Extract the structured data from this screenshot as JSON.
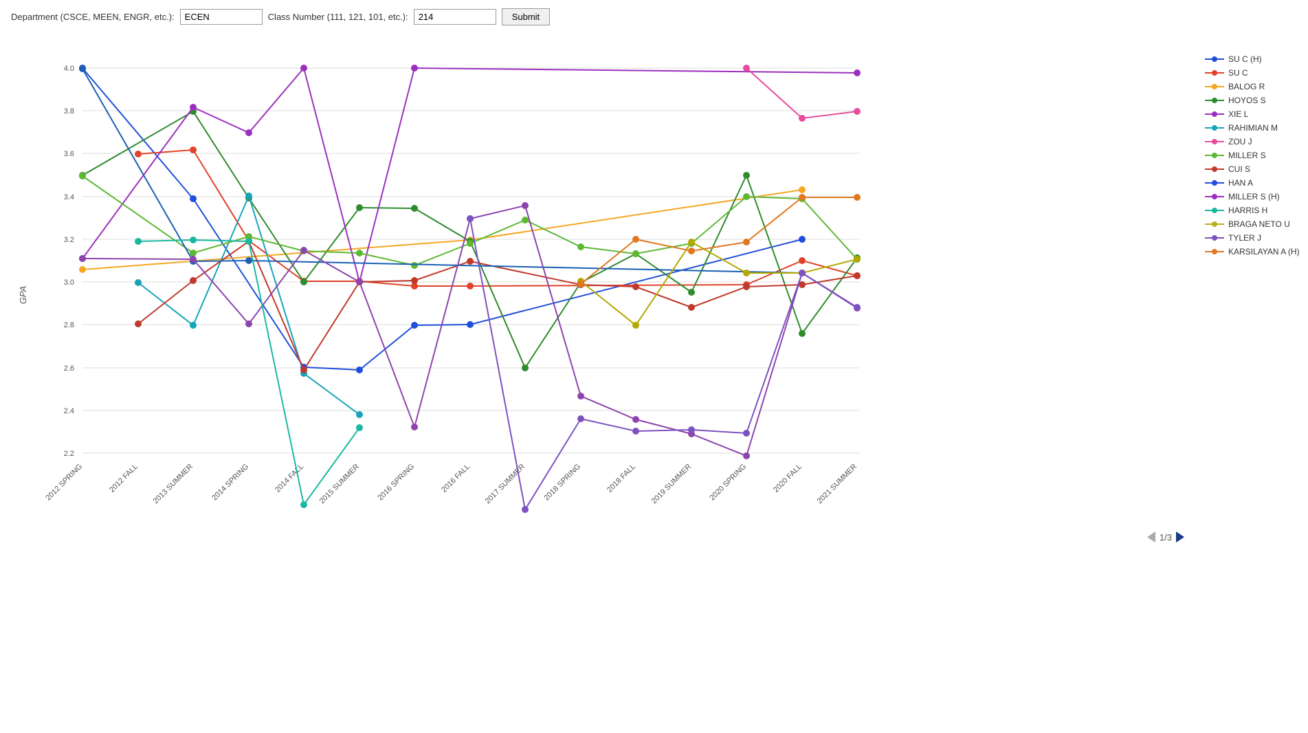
{
  "header": {
    "dept_label": "Department (CSCE, MEEN, ENGR, etc.):",
    "dept_value": "ECEN",
    "class_label": "Class Number (111, 121, 101, etc.):",
    "class_value": "214",
    "submit_label": "Submit"
  },
  "chart": {
    "y_label": "GPA",
    "y_min": 2.2,
    "y_max": 4.0,
    "x_labels": [
      "2012 SPRING",
      "2012 FALL",
      "2013 SUMMER",
      "2014 SPRING",
      "2014 FALL",
      "2015 SUMMER",
      "2016 SPRING",
      "2016 FALL",
      "2017 SUMMER",
      "2018 SPRING",
      "2018 FALL",
      "2019 SUMMER",
      "2020 SPRING",
      "2020 FALL",
      "2021 SUMMER"
    ],
    "pagination": "1/3"
  },
  "legend": [
    {
      "name": "SU C (H)",
      "color": "#1f4edb"
    },
    {
      "name": "SU C",
      "color": "#e0422a"
    },
    {
      "name": "BALOG R",
      "color": "#f5a623"
    },
    {
      "name": "HOYOS S",
      "color": "#2e8b2e"
    },
    {
      "name": "XIE L",
      "color": "#9b30c0"
    },
    {
      "name": "RAHIMIAN M",
      "color": "#17a3b8"
    },
    {
      "name": "ZOU J",
      "color": "#e84c9c"
    },
    {
      "name": "MILLER S",
      "color": "#5db832"
    },
    {
      "name": "CUI S",
      "color": "#c0392b"
    },
    {
      "name": "HAN A",
      "color": "#1f4edb"
    },
    {
      "name": "MILLER S (H)",
      "color": "#9b30c0"
    },
    {
      "name": "HARRIS H",
      "color": "#1ab8a0"
    },
    {
      "name": "BRAGA NETO U",
      "color": "#b8b020"
    },
    {
      "name": "TYLER J",
      "color": "#7b52c0"
    },
    {
      "name": "KARSILAYAN A (H)",
      "color": "#e07820"
    }
  ]
}
